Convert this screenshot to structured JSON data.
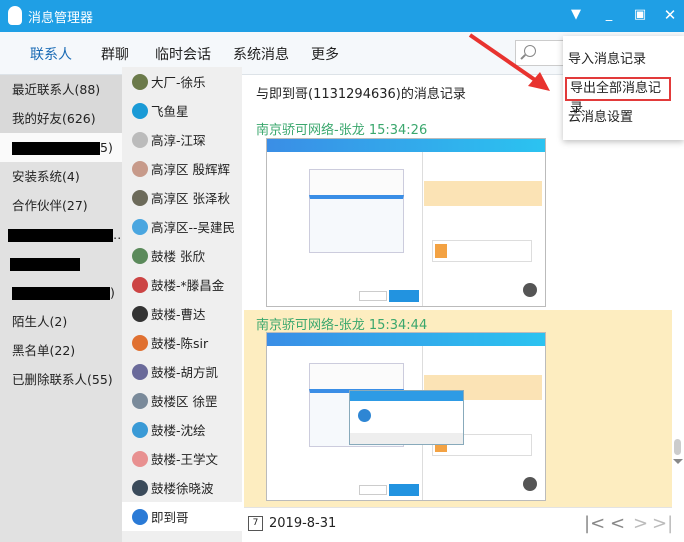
{
  "window": {
    "title": "消息管理器"
  },
  "nav": {
    "tabs": [
      {
        "label": "联系人"
      },
      {
        "label": "群聊"
      },
      {
        "label": "临时会话"
      },
      {
        "label": "系统消息"
      },
      {
        "label": "更多"
      }
    ]
  },
  "menu": {
    "items": [
      {
        "label": "导入消息记录"
      },
      {
        "label": "导出全部消息记录"
      },
      {
        "label": "云消息设置"
      }
    ]
  },
  "groups": [
    {
      "label": "最近联系人(88)"
    },
    {
      "label": "我的好友(626)"
    },
    {
      "label": "5)"
    },
    {
      "label": "安装系统(4)"
    },
    {
      "label": "合作伙伴(27)"
    },
    {
      "label": "…"
    },
    {
      "label": ""
    },
    {
      "label": ")"
    },
    {
      "label": "陌生人(2)"
    },
    {
      "label": "黑名单(22)"
    },
    {
      "label": "已删除联系人(55)"
    }
  ],
  "contacts": [
    {
      "name": "大厂-徐乐",
      "color": "#6b7a4a"
    },
    {
      "name": "飞鱼星",
      "color": "#1a9ad6"
    },
    {
      "name": "高淳-江琛",
      "color": "#bbbbbb"
    },
    {
      "name": "高淳区  殷辉辉",
      "color": "#c79a8a"
    },
    {
      "name": "高淳区  张泽秋",
      "color": "#6c6a5a"
    },
    {
      "name": "高淳区--吴建民",
      "color": "#4aa6e0"
    },
    {
      "name": "鼓楼 张欣",
      "color": "#5b8a5b"
    },
    {
      "name": "鼓楼-*滕昌金",
      "color": "#c44"
    },
    {
      "name": "鼓楼-曹达",
      "color": "#333"
    },
    {
      "name": "鼓楼-陈sir",
      "color": "#e07030"
    },
    {
      "name": "鼓楼-胡方凯",
      "color": "#6a6a9a"
    },
    {
      "name": "鼓楼区 徐罡",
      "color": "#7a8a9a"
    },
    {
      "name": "鼓楼-沈绘",
      "color": "#3a9ad6"
    },
    {
      "name": "鼓楼-王学文",
      "color": "#e89090"
    },
    {
      "name": "鼓楼徐晓波",
      "color": "#3a4a5a"
    },
    {
      "name": "即到哥",
      "color": "#2a7ad6"
    }
  ],
  "main": {
    "header": "与即到哥(1131294636)的消息记录",
    "messages": [
      {
        "sender": "南京骄可网络-张龙 15:34:26"
      },
      {
        "sender": "南京骄可网络-张龙 15:34:44"
      }
    ],
    "date": "2019-8-31",
    "calendar_day": "7"
  }
}
